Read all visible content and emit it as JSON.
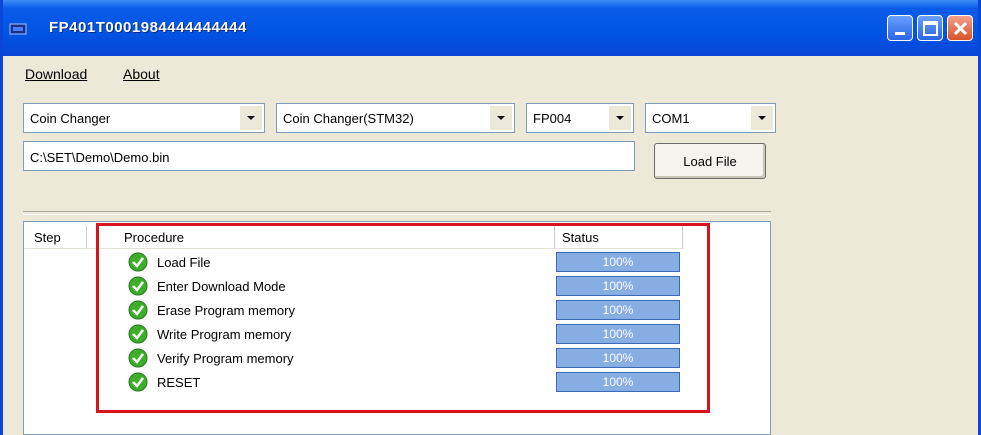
{
  "window": {
    "title": "FP401T0001984444444444",
    "colors": {
      "titlebar": "#0054e3",
      "highlight": "#d8121f",
      "status_fill": "#86aee2"
    }
  },
  "menu": [
    {
      "label": "Download",
      "mnemonic_index": 0
    },
    {
      "label": "About",
      "mnemonic_index": 0
    }
  ],
  "selectors": [
    {
      "name": "device-category",
      "value": "Coin Changer"
    },
    {
      "name": "device-model",
      "value": "Coin Changer(STM32)"
    },
    {
      "name": "firmware-version",
      "value": "FP004"
    },
    {
      "name": "com-port",
      "value": "COM1"
    }
  ],
  "file_path": "C:\\SET\\Demo\\Demo.bin",
  "load_button": "Load File",
  "table": {
    "columns": [
      "Step",
      "Procedure",
      "Status"
    ],
    "rows": [
      {
        "procedure": "Load File",
        "status": "100%",
        "icon": "check-icon"
      },
      {
        "procedure": "Enter Download Mode",
        "status": "100%",
        "icon": "check-icon"
      },
      {
        "procedure": "Erase Program memory",
        "status": "100%",
        "icon": "check-icon"
      },
      {
        "procedure": "Write Program memory",
        "status": "100%",
        "icon": "check-icon"
      },
      {
        "procedure": "Verify Program memory",
        "status": "100%",
        "icon": "check-icon"
      },
      {
        "procedure": "RESET",
        "status": "100%",
        "icon": "check-icon"
      }
    ]
  }
}
